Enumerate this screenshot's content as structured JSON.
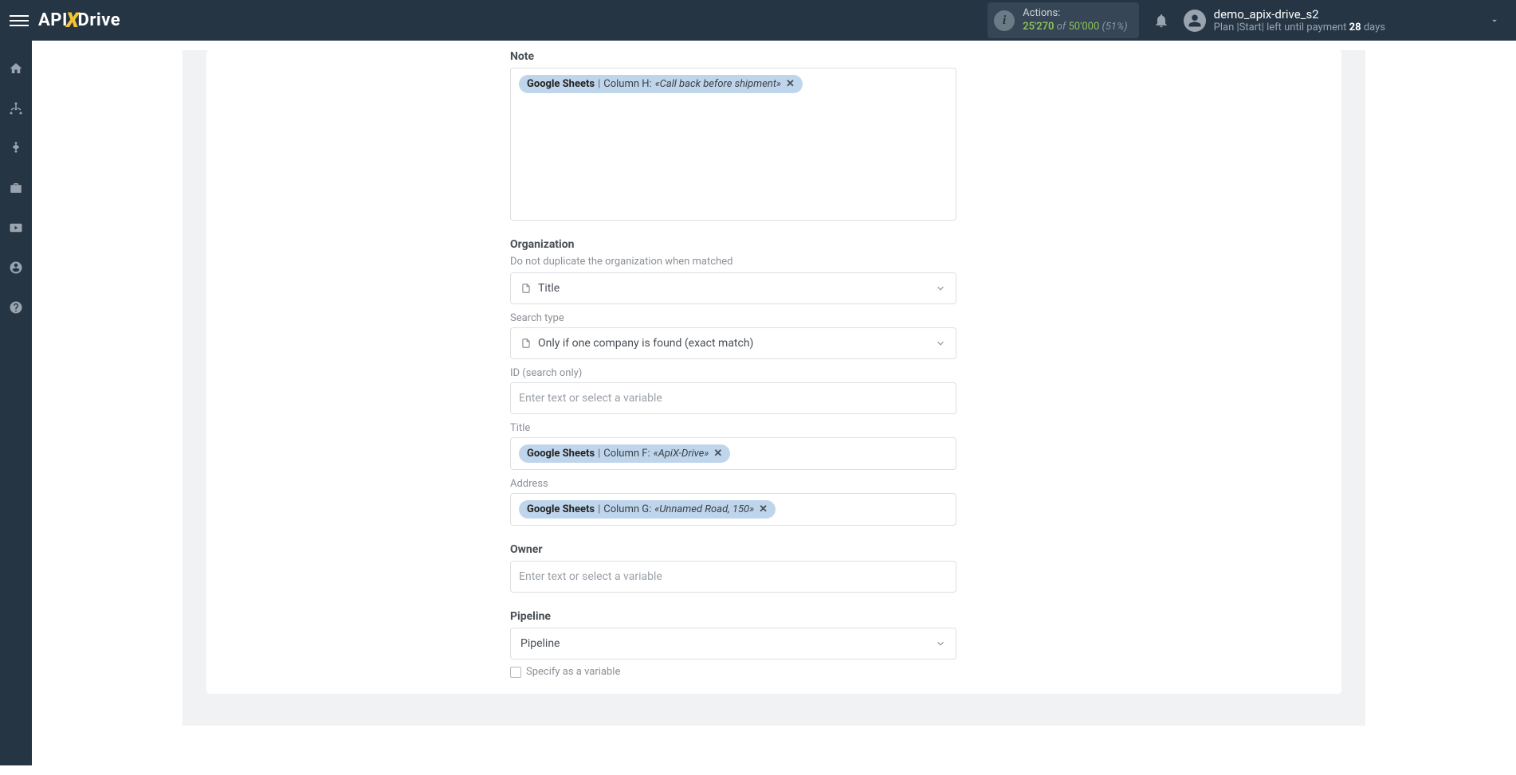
{
  "header": {
    "logo": {
      "p1": "API",
      "p2": "X",
      "p3": "Drive"
    },
    "actions": {
      "label": "Actions:",
      "used": "25'270",
      "of": "of",
      "total": "50'000",
      "pct": "(51%)"
    },
    "user": {
      "name": "demo_apix-drive_s2",
      "plan_prefix": "Plan |Start|  left until payment ",
      "days": "28",
      "days_suffix": " days"
    }
  },
  "form": {
    "note": {
      "heading": "Note",
      "chip": {
        "source": "Google Sheets",
        "separator": " | ",
        "column": "Column H: ",
        "value": "«Call back before shipment»"
      }
    },
    "organization": {
      "heading": "Organization",
      "sub": "Do not duplicate the organization when matched",
      "match_select": "Title",
      "search_type_label": "Search type",
      "search_type_value": "Only if one company is found (exact match)",
      "id_label": "ID (search only)",
      "id_placeholder": "Enter text or select a variable",
      "title_label": "Title",
      "title_chip": {
        "source": "Google Sheets",
        "separator": " | ",
        "column": "Column F: ",
        "value": "«ApiX-Drive»"
      },
      "address_label": "Address",
      "address_chip": {
        "source": "Google Sheets",
        "separator": " | ",
        "column": "Column G: ",
        "value": "«Unnamed Road, 150»"
      }
    },
    "owner": {
      "heading": "Owner",
      "placeholder": "Enter text or select a variable"
    },
    "pipeline": {
      "heading": "Pipeline",
      "value": "Pipeline",
      "checkbox": "Specify as a variable"
    }
  }
}
